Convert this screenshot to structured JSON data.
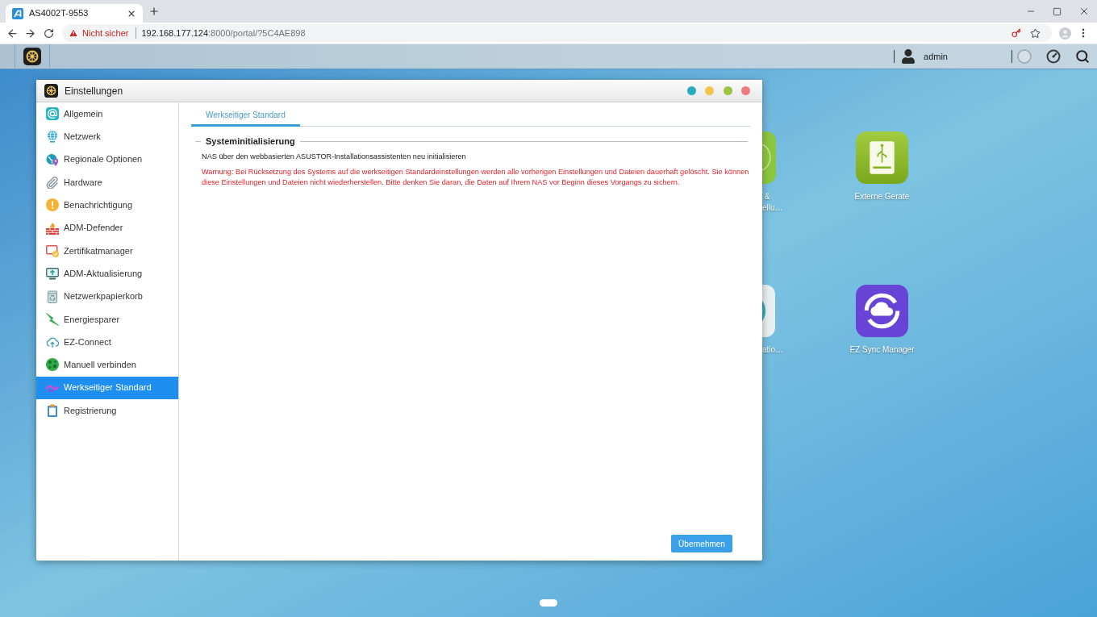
{
  "browser": {
    "tab": {
      "title": "AS4002T-9553"
    },
    "address_bar": {
      "security": "Nicht sicher",
      "host": "192.168.177.124",
      "path": ":8000/portal/?5C4AE898"
    }
  },
  "taskbar": {
    "user": "admin"
  },
  "window": {
    "title": "Einstellungen",
    "controls": [
      {
        "color": "#2aabbf"
      },
      {
        "color": "#f4c54a"
      },
      {
        "color": "#9cc33d"
      },
      {
        "color": "#ef7c7c"
      }
    ],
    "sidebar": {
      "items": [
        {
          "label": "Allgemein",
          "selected": false
        },
        {
          "label": "Netzwerk",
          "selected": false
        },
        {
          "label": "Regionale Optionen",
          "selected": false
        },
        {
          "label": "Hardware",
          "selected": false
        },
        {
          "label": "Benachrichtigung",
          "selected": false
        },
        {
          "label": "ADM-Defender",
          "selected": false
        },
        {
          "label": "Zertifikatmanager",
          "selected": false
        },
        {
          "label": "ADM-Aktualisierung",
          "selected": false
        },
        {
          "label": "Netzwerkpapierkorb",
          "selected": false
        },
        {
          "label": "Energiesparer",
          "selected": false
        },
        {
          "label": "EZ-Connect",
          "selected": false
        },
        {
          "label": "Manuell verbinden",
          "selected": false
        },
        {
          "label": "Werkseitiger Standard",
          "selected": true
        },
        {
          "label": "Registrierung",
          "selected": false
        }
      ]
    },
    "tabs": [
      {
        "label": "Werkseitiger Standard",
        "selected": true
      }
    ],
    "section": {
      "title": "Systeminitialisierung",
      "description": "NAS über den webbasierten ASUSTOR-Installationsassistenten neu initialisieren",
      "warning": "Warnung: Bei Rücksetzung des Systems auf die werkseitigen Standardeinstellungen werden alle vorherigen Einstellungen und Dateien dauerhaft gelöscht. Sie können diese Einstellungen und Dateien nicht wiederherstellen. Bitte denken Sie daran, die Daten auf Ihrem NAS vor Beginn dieses Vorgangs zu sichern."
    },
    "buttons": [
      "Übernehmen"
    ]
  },
  "desktop": {
    "icons": [
      {
        "label": "Externe Gerate"
      },
      {
        "label": "EZ Sync Manager"
      }
    ],
    "partly_hidden_icons": [
      {
        "label_lines": [
          "&",
          "ellu…"
        ]
      },
      {
        "label_lines": [
          "atio…"
        ]
      }
    ]
  }
}
